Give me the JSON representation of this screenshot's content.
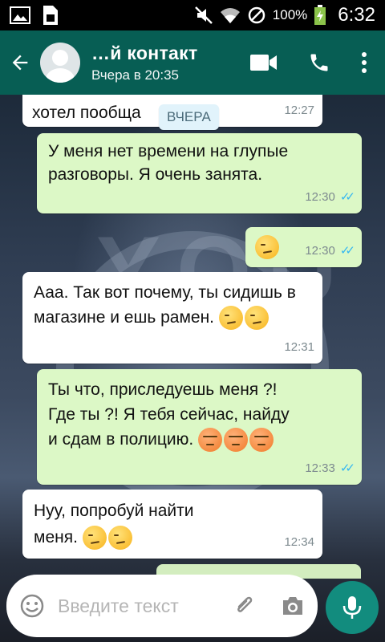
{
  "status_bar": {
    "battery": "100%",
    "time": "6:32"
  },
  "header": {
    "title": "…й контакт",
    "subtitle": "Вчера в 20:35"
  },
  "date_chip": "ВЧЕРА",
  "messages": [
    {
      "dir": "in",
      "text": "хотел пообща",
      "time": "12:27"
    },
    {
      "dir": "out",
      "text": "У меня нет времени на глупые разговоры. Я очень занята.",
      "time": "12:30",
      "status": "read"
    },
    {
      "dir": "out",
      "text": "",
      "emoji": [
        "unamused"
      ],
      "time": "12:30",
      "status": "read"
    },
    {
      "dir": "in",
      "text": "Ааа. Так вот почему, ты сидишь в магазине и ешь рамен.",
      "emoji": [
        "smirk",
        "smirk"
      ],
      "time": "12:31"
    },
    {
      "dir": "out",
      "text": "Ты что,  приследуешь меня ?! Где ты ?! Я тебя сейчас, найду и сдам в полицию.",
      "emoji": [
        "angry",
        "angry",
        "angry"
      ],
      "time": "12:33",
      "status": "read"
    },
    {
      "dir": "in",
      "text": "Нуу, попробуй найти меня.",
      "emoji": [
        "smirk",
        "smirk"
      ],
      "time": "12:34"
    }
  ],
  "input": {
    "placeholder": "Введите текст"
  },
  "colors": {
    "header": "#075e54",
    "outgoing": "#dcf8c6",
    "incoming": "#ffffff",
    "read_ticks": "#34b7f1",
    "mic_button": "#128c7e"
  },
  "icons": [
    "back-arrow-icon",
    "avatar-icon",
    "video-call-icon",
    "phone-icon",
    "more-icon",
    "emoji-icon",
    "attach-icon",
    "camera-icon",
    "mic-icon"
  ]
}
